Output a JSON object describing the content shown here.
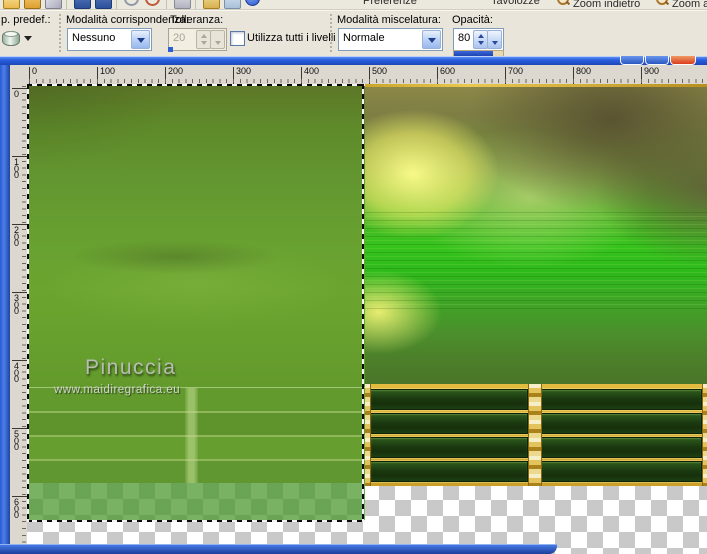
{
  "main_toolbar": {
    "icons": [
      "new",
      "open",
      "eraser",
      "|",
      "save",
      "save-all",
      "|",
      "undo",
      "redo",
      "|",
      "print",
      "|",
      "browse",
      "capture",
      "info"
    ],
    "text_items": [
      {
        "name": "preferences-button",
        "label": "Preferenze"
      },
      {
        "name": "palettes-button",
        "label": "Tavolozze"
      },
      {
        "name": "zoom-out-button",
        "label": "Zoom indietro",
        "icon": "zoom-out-icon"
      },
      {
        "name": "zoom-in-button",
        "label": "Zoom avanti",
        "icon": "zoom-in-icon"
      }
    ]
  },
  "options_bar": {
    "preset": {
      "label": "p. predef.:"
    },
    "match_mode": {
      "label": "Modalità corrispondenza:",
      "value": "Nessuno"
    },
    "tolerance": {
      "label": "Tolleranza:",
      "value": "20",
      "enabled": false
    },
    "use_all_layers": {
      "label": "Utilizza tutti i livelli",
      "checked": false
    },
    "blend_mode": {
      "label": "Modalità miscelatura:",
      "value": "Normale"
    },
    "opacity": {
      "label": "Opacità:",
      "value": "80",
      "fill_percent": 80
    }
  },
  "rulers": {
    "horizontal": [
      "0",
      "100",
      "200",
      "300",
      "400",
      "500",
      "600",
      "700",
      "800",
      "900"
    ],
    "vertical": [
      "0",
      "100",
      "200",
      "300",
      "400",
      "500",
      "600"
    ]
  },
  "canvas": {
    "watermark": {
      "artist": "Pinuccia",
      "website": "www.maidiregrafica.eu"
    },
    "selection_visible": true
  },
  "colors": {
    "titlebar_blue": "#2a5ede",
    "close_button_red": "#d83c1c",
    "opacity_bar_blue": "#2b59c8",
    "gold_frame": "#caa028",
    "bright_water_green": "#36c31c",
    "layer_green": "#68a130",
    "checker_gray": "#c9c9c9"
  }
}
